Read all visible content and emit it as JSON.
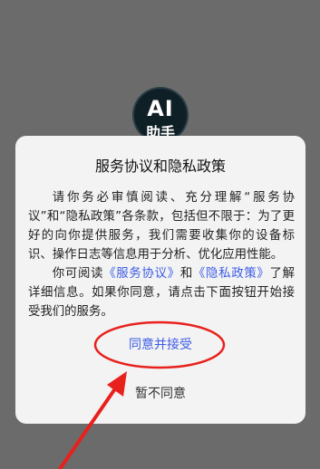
{
  "app": {
    "logo_line1": "AI",
    "logo_line2": "助手"
  },
  "dialog": {
    "title": "服务协议和隐私政策",
    "para1": "请你务必审慎阅读、充分理解“服务协议”和“隐私政策”各条款，包括但不限于：为了更好的向你提供服务，我们需要收集你的设备标识、操作日志等信息用于分析、优化应用性能。",
    "para2_before": "你可阅读",
    "link_service": "《服务协议》",
    "para2_and": "和",
    "link_privacy": "《隐私政策》",
    "para2_after": "了解详细信息。如果你同意，请点击下面按钮开始接受我们的服务。",
    "agree_label": "同意并接受",
    "decline_label": "暂不同意"
  },
  "colors": {
    "backdrop": "#6b6b6b",
    "dialog_bg": "#f3f3f3",
    "link": "#3d5ce6",
    "annotation_red": "#e8211d"
  },
  "icons": {
    "logo": "ai-assistant-logo-icon",
    "annotation": "red-arrow-icon"
  }
}
